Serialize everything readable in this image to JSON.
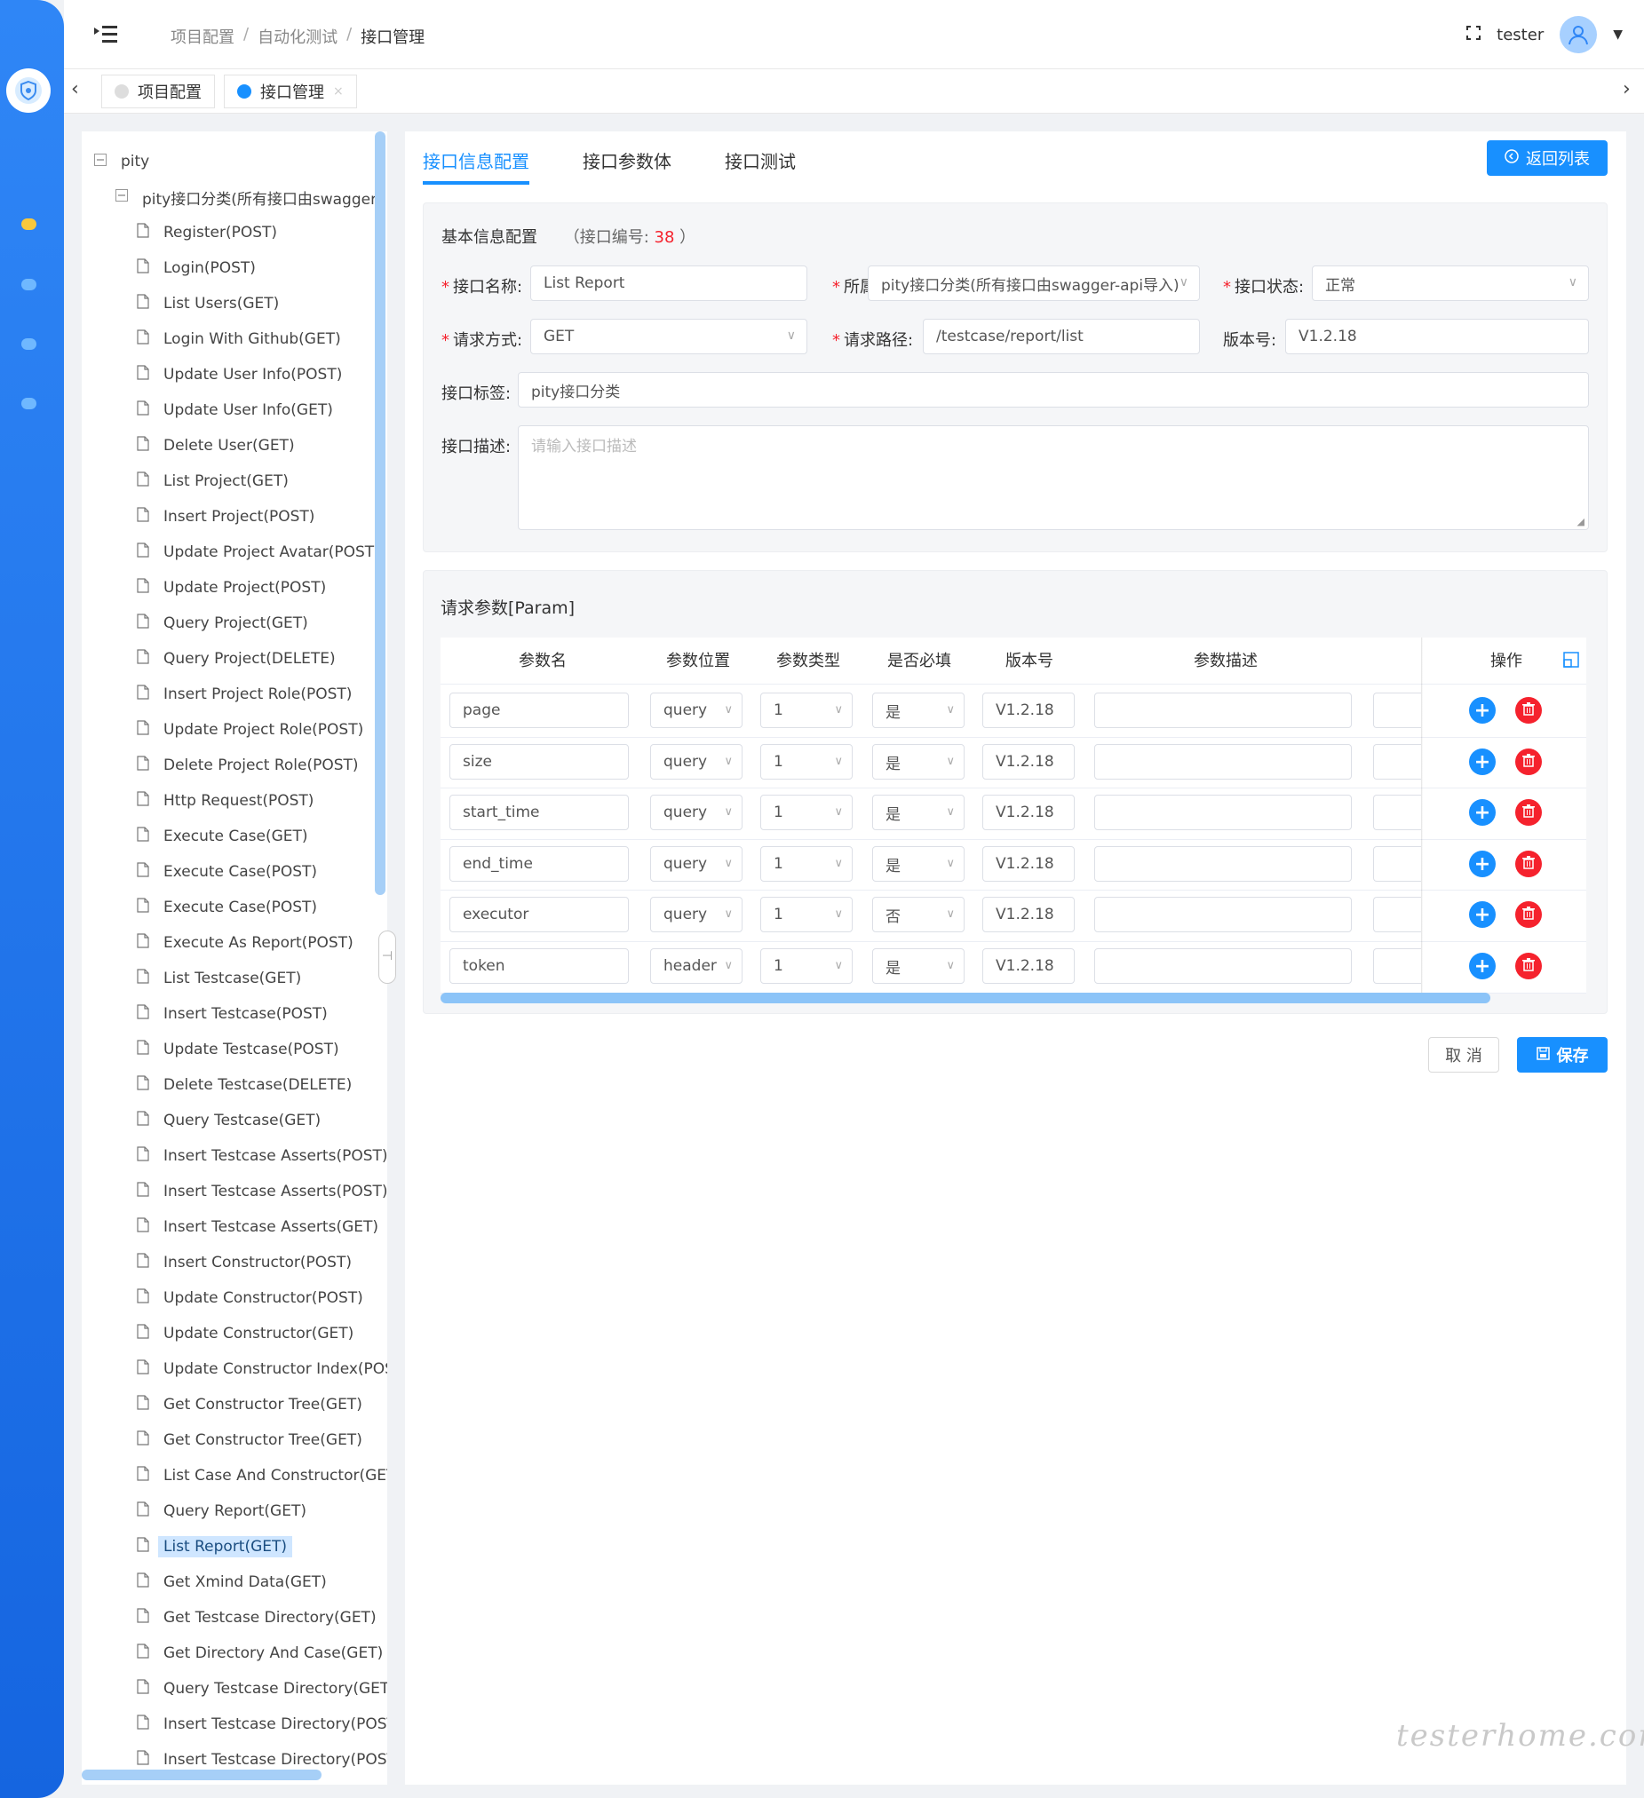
{
  "header": {
    "breadcrumbs": [
      "项目配置",
      "自动化测试",
      "接口管理"
    ],
    "username": "tester"
  },
  "nav_tabs": [
    {
      "label": "项目配置",
      "active": false
    },
    {
      "label": "接口管理",
      "active": true
    }
  ],
  "tree": {
    "root": "pity",
    "category": "pity接口分类(所有接口由swagger-",
    "items": [
      "Register(POST)",
      "Login(POST)",
      "List Users(GET)",
      "Login With Github(GET)",
      "Update User Info(POST)",
      "Update User Info(GET)",
      "Delete User(GET)",
      "List Project(GET)",
      "Insert Project(POST)",
      "Update Project Avatar(POST)",
      "Update Project(POST)",
      "Query Project(GET)",
      "Query Project(DELETE)",
      "Insert Project Role(POST)",
      "Update Project Role(POST)",
      "Delete Project Role(POST)",
      "Http Request(POST)",
      "Execute Case(GET)",
      "Execute Case(POST)",
      "Execute Case(POST)",
      "Execute As Report(POST)",
      "List Testcase(GET)",
      "Insert Testcase(POST)",
      "Update Testcase(POST)",
      "Delete Testcase(DELETE)",
      "Query Testcase(GET)",
      "Insert Testcase Asserts(POST)",
      "Insert Testcase Asserts(POST)",
      "Insert Testcase Asserts(GET)",
      "Insert Constructor(POST)",
      "Update Constructor(POST)",
      "Update Constructor(GET)",
      "Update Constructor Index(POS",
      "Get Constructor Tree(GET)",
      "Get Constructor Tree(GET)",
      "List Case And Constructor(GET)",
      "Query Report(GET)",
      "List Report(GET)",
      "Get Xmind Data(GET)",
      "Get Testcase Directory(GET)",
      "Get Directory And Case(GET)",
      "Query Testcase Directory(GET)",
      "Insert Testcase Directory(POST)",
      "Insert Testcase Directory(POST)"
    ],
    "selected_index": 37
  },
  "main": {
    "tabs": [
      "接口信息配置",
      "接口参数体",
      "接口测试"
    ],
    "back_button": "返回列表",
    "basic": {
      "title": "基本信息配置",
      "id_prefix": "（接口编号: ",
      "id_value": "38",
      "id_suffix": " ）",
      "name_label": "接口名称:",
      "name_value": "List Report",
      "category_label": "所属",
      "category_value": "pity接口分类(所有接口由swagger-api导入)",
      "status_label": "接口状态:",
      "status_value": "正常",
      "method_label": "请求方式:",
      "method_value": "GET",
      "path_label": "请求路径:",
      "path_value": "/testcase/report/list",
      "version_label": "版本号:",
      "version_value": "V1.2.18",
      "tag_label": "接口标签:",
      "tag_value": "pity接口分类",
      "desc_label": "接口描述:",
      "desc_placeholder": "请输入接口描述"
    },
    "params": {
      "title": "请求参数[Param]",
      "headers": [
        "参数名",
        "参数位置",
        "参数类型",
        "是否必填",
        "版本号",
        "参数描述",
        "操作"
      ],
      "rows": [
        {
          "name": "page",
          "position": "query",
          "type": "1",
          "required": "是",
          "version": "V1.2.18"
        },
        {
          "name": "size",
          "position": "query",
          "type": "1",
          "required": "是",
          "version": "V1.2.18"
        },
        {
          "name": "start_time",
          "position": "query",
          "type": "1",
          "required": "是",
          "version": "V1.2.18"
        },
        {
          "name": "end_time",
          "position": "query",
          "type": "1",
          "required": "是",
          "version": "V1.2.18"
        },
        {
          "name": "executor",
          "position": "query",
          "type": "1",
          "required": "否",
          "version": "V1.2.18"
        },
        {
          "name": "token",
          "position": "header",
          "type": "1",
          "required": "是",
          "version": "V1.2.18"
        }
      ]
    },
    "cancel_button": "取 消",
    "save_button": "保存"
  },
  "watermark": "testerhome.com",
  "colors": {
    "primary": "#1890ff",
    "danger": "#f5222d",
    "required": "#f5222d"
  }
}
